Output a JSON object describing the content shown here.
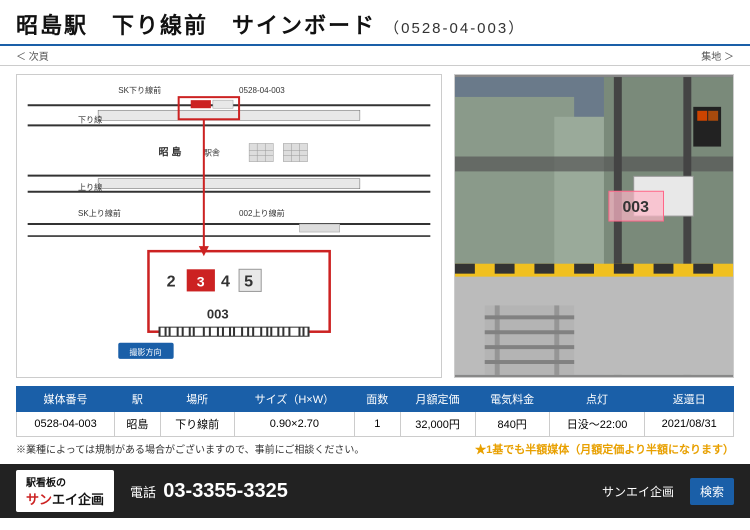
{
  "header": {
    "title": "昭島駅　下り線前　サインボード",
    "code": "（0528-04-003）"
  },
  "breadcrumb": {
    "left": "＜ 次頁",
    "right": "集地 ＞"
  },
  "photo": {
    "label": "003"
  },
  "table": {
    "headers": [
      "媒体番号",
      "駅",
      "場所",
      "サイズ（H×W）",
      "面数",
      "月額定価",
      "電気料金",
      "点灯",
      "返還日"
    ],
    "row": [
      "0528-04-003",
      "昭島",
      "下り線前",
      "0.90×2.70",
      "1",
      "32,000円",
      "840円",
      "日没〜22:00",
      "2021/08/31"
    ]
  },
  "notes": {
    "disclaimer": "※業種によっては規制がある場合がございますので、事前にご相談ください。",
    "promo": "★1基でも半額媒体（月額定価より半額になります）"
  },
  "footer": {
    "logo_line1": "駅看板の",
    "logo_line2": "サンエイ企画",
    "phone_label": "電話",
    "phone_number": "03-3355-3325",
    "brand": "サンエイ企画",
    "search_label": "検索"
  },
  "diagram": {
    "location_label": "003",
    "box_numbers": [
      "2",
      "3",
      "4",
      "5"
    ],
    "arrow_label": "撮影方向"
  }
}
